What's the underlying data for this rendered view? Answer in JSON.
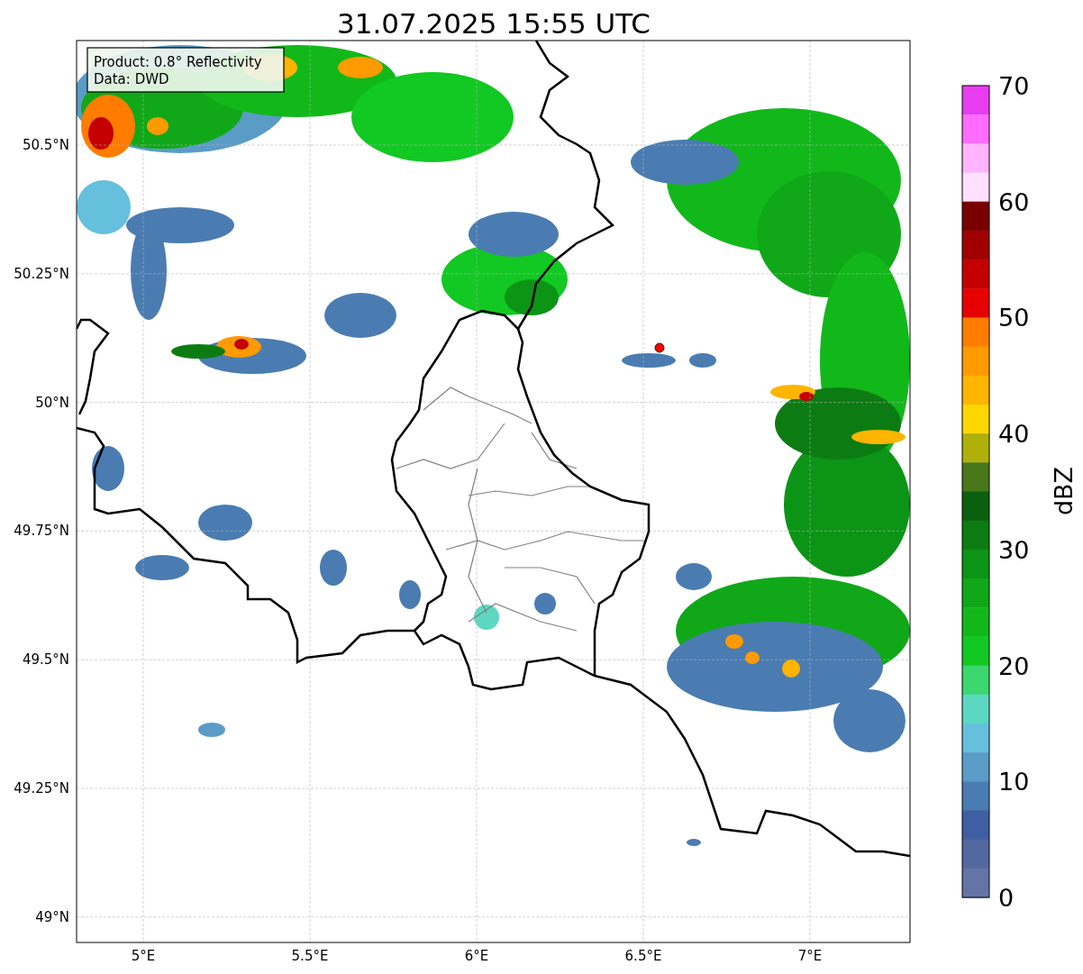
{
  "title": "31.07.2025 15:55 UTC",
  "legend": [
    "Product: 0.8° Reflectivity",
    "Data: DWD"
  ],
  "x_ticks": [
    "5°E",
    "5.5°E",
    "6°E",
    "6.5°E",
    "7°E"
  ],
  "y_ticks": [
    "50.5°N",
    "50.25°N",
    "50°N",
    "49.75°N",
    "49.5°N",
    "49.25°N",
    "49°N"
  ],
  "colorbar": {
    "label": "dBZ",
    "ticks": [
      "70",
      "60",
      "50",
      "40",
      "30",
      "20",
      "10",
      "0"
    ],
    "segments": [
      {
        "color": "#e83cf0"
      },
      {
        "color": "#ff6cff"
      },
      {
        "color": "#ffb4ff"
      },
      {
        "color": "#ffe0ff"
      },
      {
        "color": "#780000"
      },
      {
        "color": "#a00000"
      },
      {
        "color": "#c40000"
      },
      {
        "color": "#e60000"
      },
      {
        "color": "#ff7c00"
      },
      {
        "color": "#ff9a00"
      },
      {
        "color": "#ffb400"
      },
      {
        "color": "#ffd700"
      },
      {
        "color": "#b0b00a"
      },
      {
        "color": "#48781a"
      },
      {
        "color": "#0a600e"
      },
      {
        "color": "#0c7c12"
      },
      {
        "color": "#0c9416"
      },
      {
        "color": "#10a818"
      },
      {
        "color": "#12b81a"
      },
      {
        "color": "#12c822"
      },
      {
        "color": "#3cd66e"
      },
      {
        "color": "#5cd8c2"
      },
      {
        "color": "#64c0dc"
      },
      {
        "color": "#5a9cc6"
      },
      {
        "color": "#4a7cb2"
      },
      {
        "color": "#405ea2"
      },
      {
        "color": "#5468a0"
      },
      {
        "color": "#6474a6"
      }
    ]
  }
}
